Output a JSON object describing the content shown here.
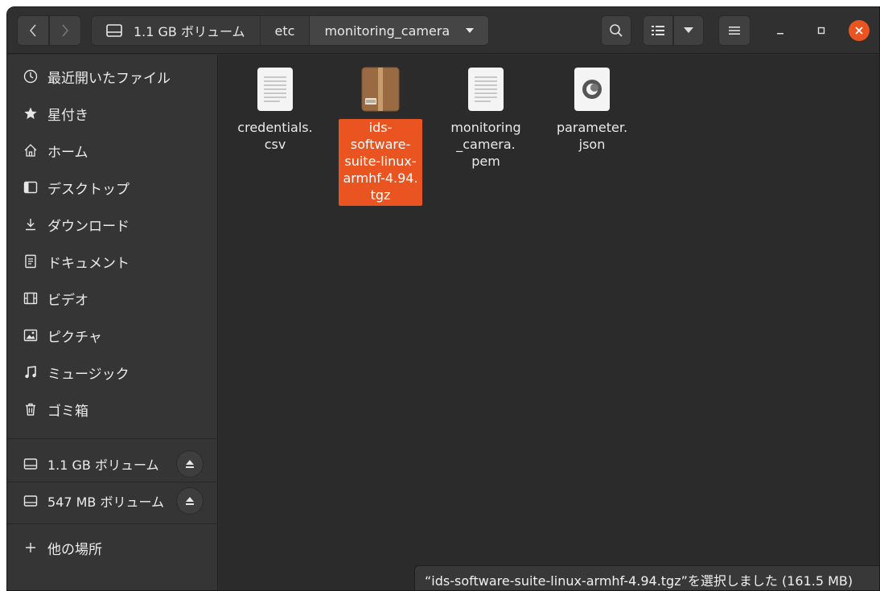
{
  "header": {
    "path": [
      {
        "label": "1.1 GB ボリューム",
        "icon": "drive-icon"
      },
      {
        "label": "etc"
      },
      {
        "label": "monitoring_camera",
        "icon": "chevron-down-icon"
      }
    ]
  },
  "sidebar": {
    "items": [
      {
        "label": "最近開いたファイル",
        "icon": "clock-icon"
      },
      {
        "label": "星付き",
        "icon": "star-icon"
      },
      {
        "label": "ホーム",
        "icon": "home-icon"
      },
      {
        "label": "デスクトップ",
        "icon": "desktop-icon"
      },
      {
        "label": "ダウンロード",
        "icon": "download-icon"
      },
      {
        "label": "ドキュメント",
        "icon": "document-icon"
      },
      {
        "label": "ビデオ",
        "icon": "video-icon"
      },
      {
        "label": "ピクチャ",
        "icon": "picture-icon"
      },
      {
        "label": "ミュージック",
        "icon": "music-icon"
      },
      {
        "label": "ゴミ箱",
        "icon": "trash-icon"
      }
    ],
    "volumes": [
      {
        "label": "1.1 GB ボリューム",
        "icon": "drive-icon"
      },
      {
        "label": "547 MB ボリューム",
        "icon": "drive-icon"
      }
    ],
    "other_label": "他の場所"
  },
  "files": [
    {
      "name": "credentials.\ncsv",
      "type": "text",
      "selected": false
    },
    {
      "name": "ids-\nsoftware-\nsuite-linux-\narmhf-4.94.\ntgz",
      "type": "archive",
      "selected": true
    },
    {
      "name": "monitoring\n_camera.\npem",
      "type": "text",
      "selected": false
    },
    {
      "name": "parameter.\njson",
      "type": "json",
      "selected": false
    }
  ],
  "status": "“ids-software-suite-linux-armhf-4.94.tgz”を選択しました (161.5 MB)",
  "colors": {
    "accent": "#e95420",
    "window_bg": "#2b2b2b",
    "sidebar_bg": "#353535"
  }
}
